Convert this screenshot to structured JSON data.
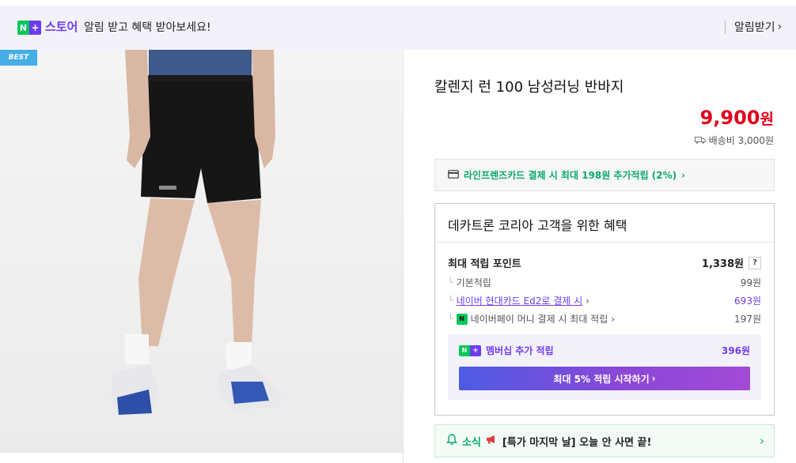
{
  "banner": {
    "badge_n": "N",
    "badge_plus": "+",
    "store_label": "스토어",
    "message": "알림 받고 혜택 받아보세요!",
    "subscribe_label": "알림받기"
  },
  "product": {
    "badge": "BEST",
    "title": "칼렌지 런 100 남성러닝 반바지",
    "price": "9,900",
    "price_unit": "원",
    "shipping": "배송비 3,000원"
  },
  "card_promo": "라인프렌즈카드 결제 시 최대 198원 추가적립 (2%)",
  "benefits": {
    "title": "데카트론 코리아 고객을 위한 혜택",
    "max_points_label": "최대 적립 포인트",
    "max_points_value": "1,338원",
    "help": "?",
    "rows": [
      {
        "label": "기본적립",
        "value": "99원"
      },
      {
        "label": "네이버 현대카드 Ed2로 결제 시",
        "value": "693원"
      },
      {
        "label": "네이버페이 머니 결제 시 최대 적립",
        "value": "197원"
      }
    ],
    "member_label": "멤버십 추가 적립",
    "member_value": "396원",
    "member_button": "최대 5% 적립 시작하기"
  },
  "news": {
    "label": "소식",
    "text": "[특가 마지막 날] 오늘 안 사면 끝!"
  },
  "colors": {
    "accent_purple": "#6e3cf0",
    "naver_green": "#03c75a",
    "price_red": "#e0001e"
  }
}
